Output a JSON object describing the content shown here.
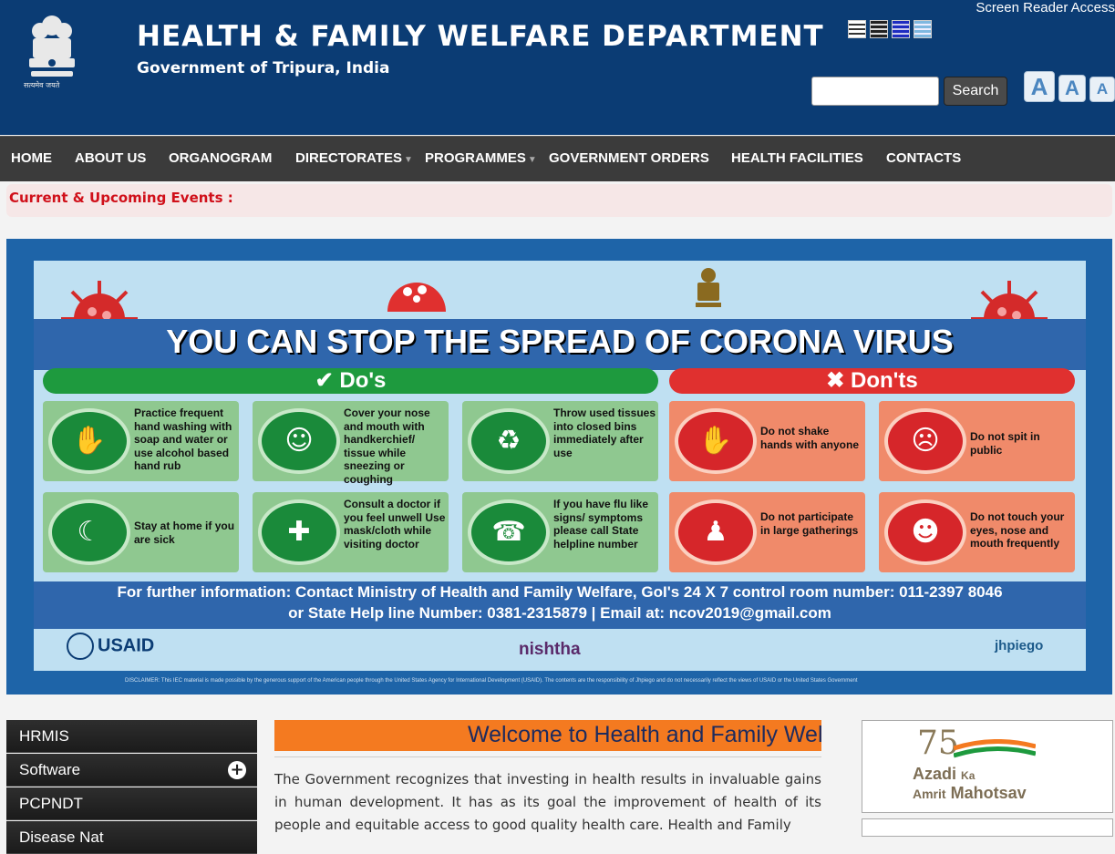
{
  "header": {
    "title": "HEALTH & FAMILY WELFARE DEPARTMENT",
    "subtitle": "Government of Tripura, India",
    "screen_reader": "Screen Reader Access",
    "emblem_motto": "सत्यमेव जयते",
    "search_button": "Search",
    "search_placeholder": "",
    "font_sizes": [
      "A",
      "A",
      "A"
    ]
  },
  "nav": {
    "items": [
      "HOME",
      "ABOUT US",
      "ORGANOGRAM",
      "DIRECTORATES",
      "PROGRAMMES",
      "GOVERNMENT ORDERS",
      "HEALTH FACILITIES",
      "CONTACTS"
    ]
  },
  "events": {
    "label": "Current & Upcoming Events :"
  },
  "banner": {
    "headline": "YOU CAN STOP THE SPREAD OF CORONA VIRUS",
    "dos_title": "Do's",
    "donts_title": "Don'ts",
    "dos": [
      "Practice frequent hand washing with soap and water or use alcohol based hand rub",
      "Cover your nose and mouth with handkerchief/ tissue while sneezing or coughing",
      "Throw used tissues into closed bins immediately after use",
      "Stay at home if you are sick",
      "Consult a doctor if you feel unwell Use mask/cloth while visiting doctor",
      "If you have flu like signs/ symptoms please call State helpline number"
    ],
    "donts": [
      "Do not shake hands with anyone",
      "Do not spit in public",
      "Do not participate in large gatherings",
      "Do not touch your eyes, nose and mouth frequently"
    ],
    "info_line1": "For further information: Contact Ministry of Health and Family Welfare, GoI's 24 X 7 control room number: 011-2397 8046",
    "info_line2": "or State Help line Number: 0381-2315879 | Email at: ncov2019@gmail.com",
    "logo_usaid": "USAID",
    "logo_nishtha": "nishtha",
    "logo_jhpiego": "jhpiego",
    "disclaimer": "DISCLAIMER: This IEC material is made possible by the generous support of the American people through the United States Agency for International Development (USAID). The contents are the responsibility of Jhpiego and do not necessarily reflect the views of USAID or the United States Government"
  },
  "sidebar": {
    "items": [
      "HRMIS",
      "Software",
      "PCPNDT",
      "Disease Nat"
    ]
  },
  "welcome": {
    "heading": "Welcome to Health and Family Welfare Department",
    "paragraph": "The Government recognizes that investing in health results in invaluable gains in human development. It has as its goal the improvement of health of its people and equitable access to good quality health care. Health and Family"
  },
  "azadi": {
    "number": "75",
    "line1": "Azadi",
    "ka": "Ka",
    "line2": "Amrit",
    "line3": "Mahotsav"
  },
  "colors": {
    "header_bg": "#0b3c74",
    "nav_bg": "#3b3b3b",
    "events_label": "#d0101a",
    "welcome_bar": "#f47a20",
    "dos_green": "#1e9a3e",
    "donts_red": "#e0302f"
  },
  "icons": {
    "contrast": [
      "contrast-default-icon",
      "contrast-dark-icon",
      "contrast-blue-icon",
      "contrast-light-icon"
    ],
    "expand": "plus-circle-icon",
    "dropdown": "chevron-down-icon"
  }
}
